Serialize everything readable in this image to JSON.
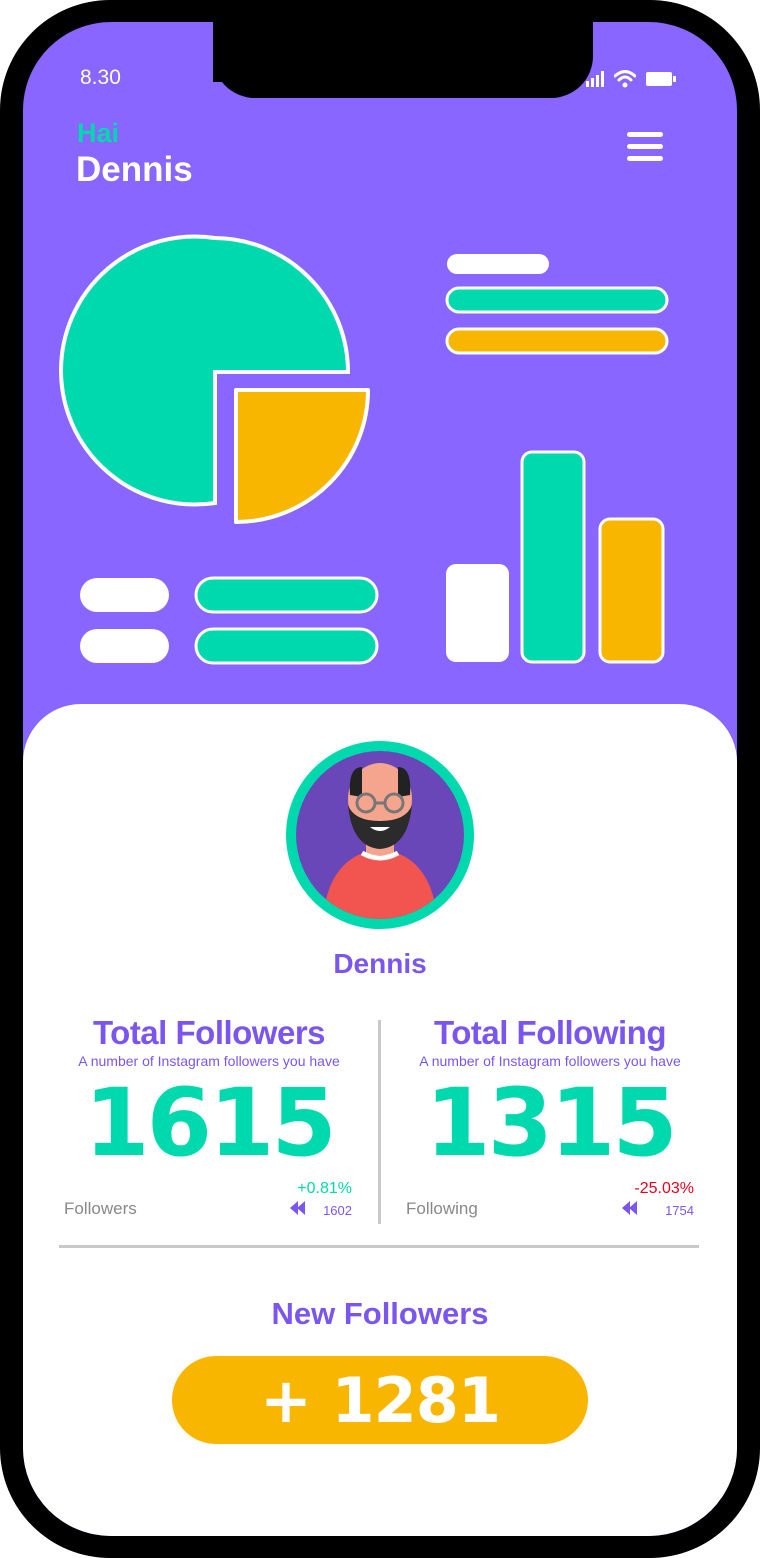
{
  "status_bar": {
    "time": "8.30",
    "signal_icon": "signal-icon",
    "wifi_icon": "wifi-icon",
    "battery_icon": "battery-icon"
  },
  "header": {
    "greeting": "Hai",
    "user_name": "Dennis",
    "menu_icon": "hamburger-menu-icon"
  },
  "colors": {
    "primary": "#8866ff",
    "accent_green": "#00d9ad",
    "accent_yellow": "#f8b600",
    "text_purple": "#7b55f0",
    "negative": "#e8001c"
  },
  "profile": {
    "name": "Dennis"
  },
  "followers": {
    "title": "Total Followers",
    "subtitle": "A number of Instagram followers you have",
    "value": "1615",
    "label": "Followers",
    "change": "+0.81%",
    "previous": "1602"
  },
  "following": {
    "title": "Total Following",
    "subtitle": "A number of Instagram followers you have",
    "value": "1315",
    "label": "Following",
    "change": "-25.03%",
    "previous": "1754"
  },
  "new_followers": {
    "title": "New Followers",
    "value": "+ 1281"
  }
}
